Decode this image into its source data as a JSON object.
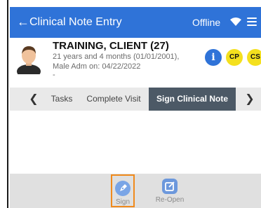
{
  "header": {
    "back_glyph": "←",
    "title": "Clinical Note Entry",
    "status": "Offline",
    "wifi_icon": "wifi-icon",
    "menu_icon": "hamburger-menu-icon",
    "color": "#2f73d8"
  },
  "client": {
    "name": "TRAINING, CLIENT (27)",
    "line1": "21 years and 4 months (01/01/2001),",
    "line2": "Male Adm on: 04/22/2022",
    "line3": "-",
    "badges": [
      "i",
      "CP",
      "CS"
    ]
  },
  "tabs": {
    "left_arrow": "❮",
    "right_arrow": "❯",
    "items": [
      {
        "label": "Tasks"
      },
      {
        "label": "Complete Visit"
      },
      {
        "label": "Sign Clinical Note",
        "active": true
      }
    ]
  },
  "footer": {
    "actions": [
      {
        "label": "Sign",
        "icon": "pen-icon",
        "highlighted": true
      },
      {
        "label": "Re-Open",
        "icon": "edit-box-icon"
      }
    ]
  }
}
